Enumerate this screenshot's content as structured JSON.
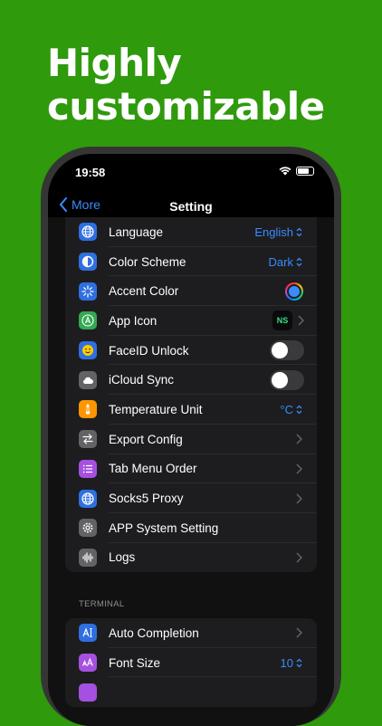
{
  "headline": {
    "line1": "Highly",
    "line2": "customizable"
  },
  "status": {
    "time": "19:58"
  },
  "nav": {
    "back_label": "More",
    "title": "Setting"
  },
  "settings": [
    {
      "label": "Language",
      "value": "English",
      "control": "select",
      "icon": "globe-icon",
      "color": "#2f6fe0"
    },
    {
      "label": "Color Scheme",
      "value": "Dark",
      "control": "select",
      "icon": "contrast-icon",
      "color": "#2f6fe0"
    },
    {
      "label": "Accent Color",
      "control": "color-swatch",
      "icon": "sparkle-icon",
      "color": "#2f6fe0"
    },
    {
      "label": "App Icon",
      "value": "NS",
      "control": "app-icon",
      "icon": "app-store-icon",
      "color": "#34a853"
    },
    {
      "label": "FaceID Unlock",
      "control": "toggle",
      "on": false,
      "icon": "faceid-icon",
      "color": "#2f6fe0"
    },
    {
      "label": "iCloud Sync",
      "control": "toggle",
      "on": false,
      "icon": "cloud-icon",
      "color": "#636366"
    },
    {
      "label": "Temperature Unit",
      "value": "°C",
      "control": "select",
      "icon": "thermometer-icon",
      "color": "#ff9500"
    },
    {
      "label": "Export Config",
      "control": "chevron",
      "icon": "arrows-icon",
      "color": "#636366"
    },
    {
      "label": "Tab Menu Order",
      "control": "chevron",
      "icon": "list-icon",
      "color": "#a550e0"
    },
    {
      "label": "Socks5 Proxy",
      "control": "chevron",
      "icon": "globe-icon",
      "color": "#2f6fe0"
    },
    {
      "label": "APP System Setting",
      "control": "none",
      "icon": "gear-icon",
      "color": "#636366"
    },
    {
      "label": "Logs",
      "control": "chevron",
      "icon": "waveform-icon",
      "color": "#636366"
    }
  ],
  "terminal": {
    "header": "TERMINAL",
    "items": [
      {
        "label": "Auto Completion",
        "control": "chevron",
        "icon": "text-cursor-icon",
        "color": "#2f6fe0"
      },
      {
        "label": "Font Size",
        "value": "10",
        "control": "select",
        "icon": "font-size-icon",
        "color": "#a550e0"
      }
    ]
  },
  "colors": {
    "background": "#2f9a0c",
    "accent": "#3a8bff"
  }
}
